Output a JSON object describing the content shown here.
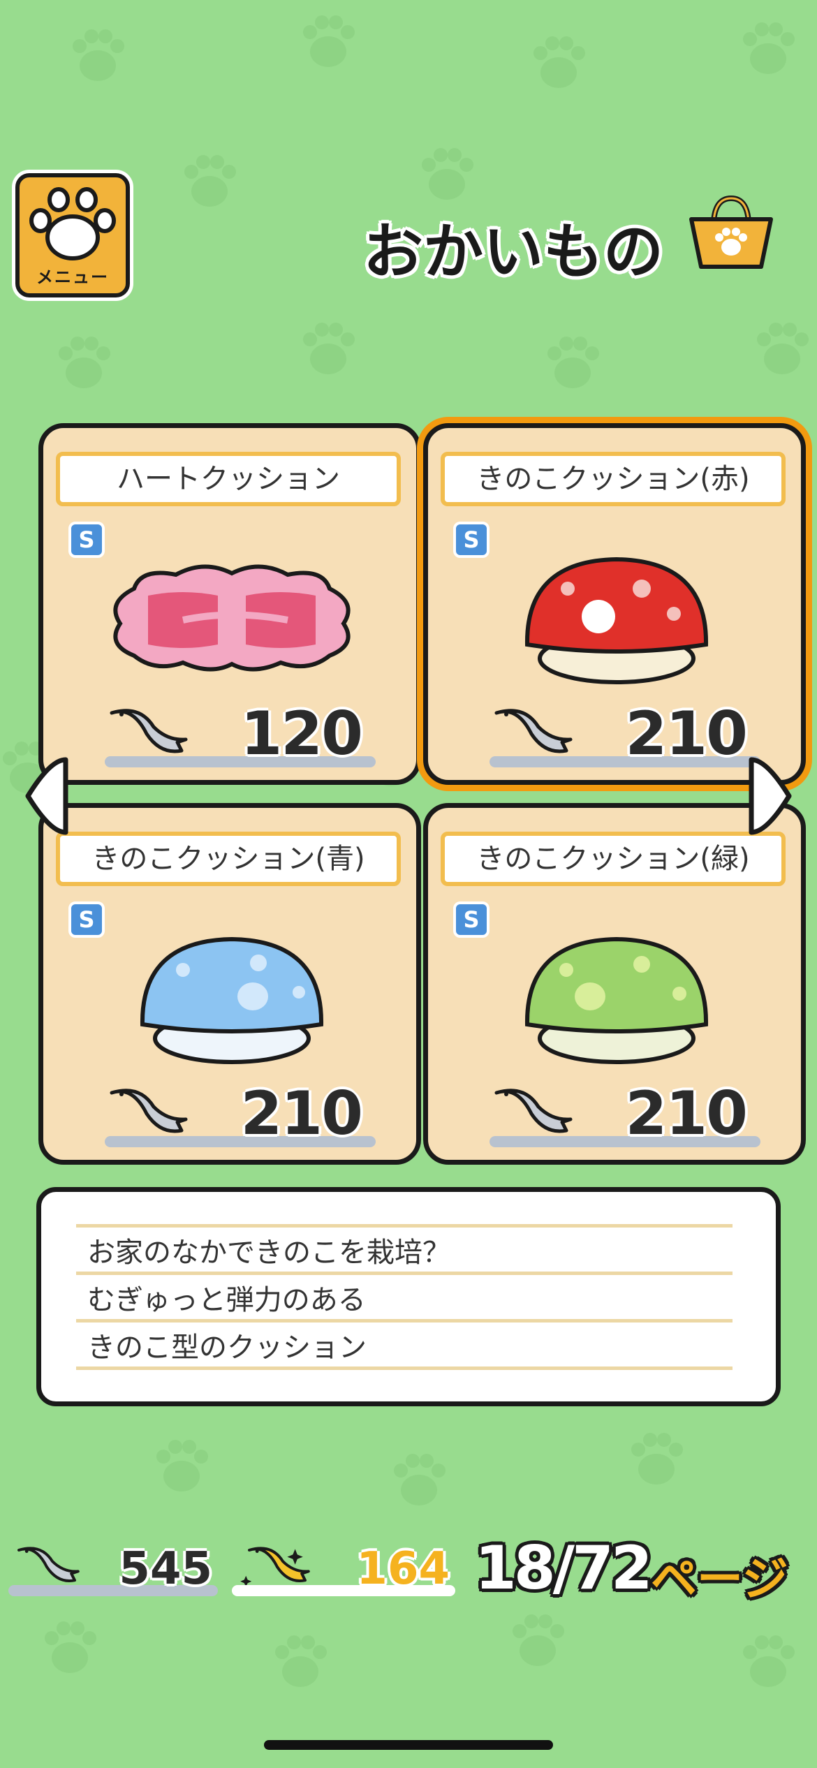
{
  "header": {
    "menu_label": "メニュー",
    "title": "おかいもの"
  },
  "items": [
    {
      "name": "ハートクッション",
      "size": "S",
      "price": "120",
      "color": "#f09ab6"
    },
    {
      "name": "きのこクッション(赤)",
      "size": "S",
      "price": "210",
      "color": "#e0302a",
      "selected": true
    },
    {
      "name": "きのこクッション(青)",
      "size": "S",
      "price": "210",
      "color": "#8cc4f2"
    },
    {
      "name": "きのこクッション(緑)",
      "size": "S",
      "price": "210",
      "color": "#9bd36a"
    }
  ],
  "description": {
    "lines": [
      "お家のなかできのこを栽培？",
      "むぎゅっと弾力のある",
      "きのこ型のクッション"
    ]
  },
  "footer": {
    "fish": "545",
    "gold_fish": "164",
    "page": "18/72",
    "page_label": "ページ"
  },
  "colors": {
    "background": "#98dc8e",
    "card": "#f7dfb7",
    "accent": "#f29a10"
  }
}
